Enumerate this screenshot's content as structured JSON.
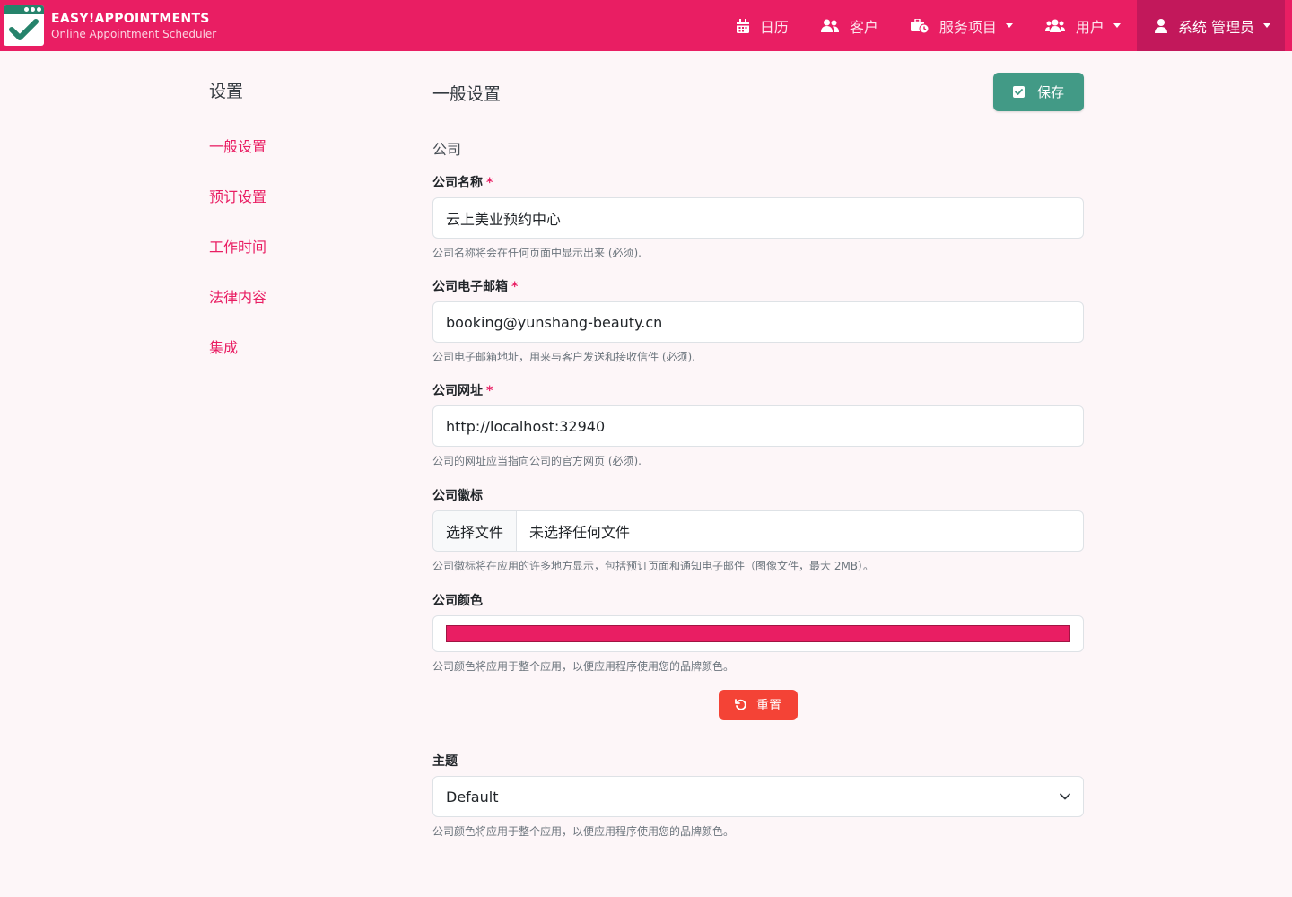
{
  "brand": {
    "title": "EASY!APPOINTMENTS",
    "subtitle": "Online Appointment Scheduler",
    "logo_icon": "checkmark-calendar-icon"
  },
  "nav": {
    "calendar": "日历",
    "customers": "客户",
    "services": "服务项目",
    "users": "用户",
    "account": "系统 管理员"
  },
  "sidebar": {
    "title": "设置",
    "items": [
      {
        "label": "一般设置"
      },
      {
        "label": "预订设置"
      },
      {
        "label": "工作时间"
      },
      {
        "label": "法律内容"
      },
      {
        "label": "集成"
      }
    ]
  },
  "main": {
    "title": "一般设置",
    "save_label": "保存",
    "section": "公司",
    "fields": {
      "company_name": {
        "label": "公司名称",
        "required_mark": "*",
        "value": "云上美业预约中心",
        "help": "公司名称将会在任何页面中显示出来 (必须)."
      },
      "company_email": {
        "label": "公司电子邮箱",
        "required_mark": "*",
        "value": "booking@yunshang-beauty.cn",
        "help": "公司电子邮箱地址，用来与客户发送和接收信件 (必须)."
      },
      "company_link": {
        "label": "公司网址",
        "required_mark": "*",
        "value": "http://localhost:32940",
        "help": "公司的网址应当指向公司的官方网页 (必须)."
      },
      "company_logo": {
        "label": "公司徽标",
        "button": "选择文件",
        "file_status": "未选择任何文件",
        "help": "公司徽标将在应用的许多地方显示，包括预订页面和通知电子邮件（图像文件，最大 2MB）。"
      },
      "company_color": {
        "label": "公司颜色",
        "value": "#e91e63",
        "help": "公司颜色将应用于整个应用，以便应用程序使用您的品牌颜色。",
        "reset_label": "重置"
      },
      "theme": {
        "label": "主题",
        "value": "Default",
        "help": "公司颜色将应用于整个应用，以便应用程序使用您的品牌颜色。"
      }
    }
  },
  "colors": {
    "brand": "#e91e63",
    "save": "#429a86",
    "reset": "#f44336"
  }
}
